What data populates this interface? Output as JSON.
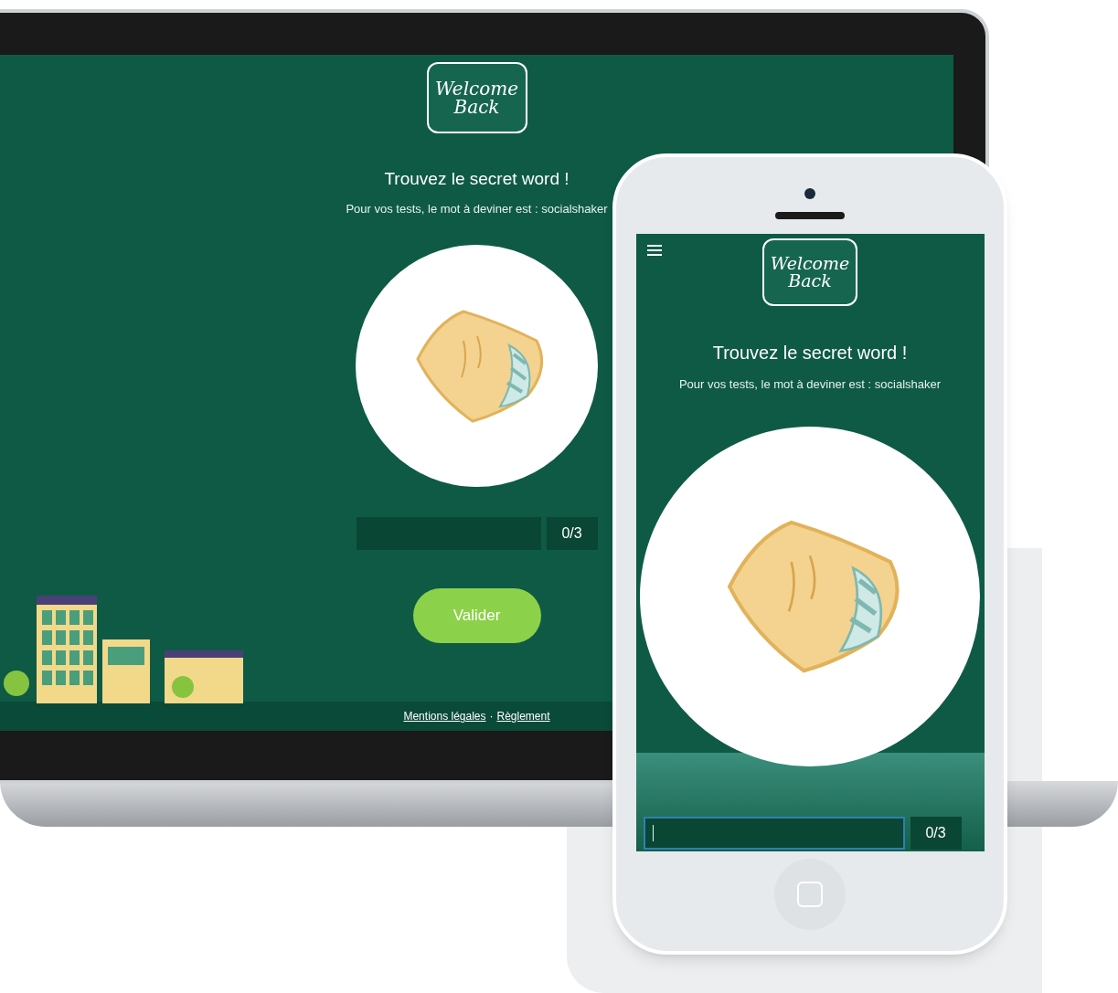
{
  "laptop": {
    "logo": [
      "Welcome",
      "Back"
    ],
    "title": "Trouvez le secret word !",
    "subtitle": "Pour vos tests, le mot à deviner est : socialshaker",
    "answer": {
      "focused": false,
      "counter": "0/3"
    },
    "button": "Valider",
    "footer_links": [
      {
        "label": "Mentions légales"
      },
      {
        "label": "Règlement"
      }
    ],
    "footer_separator": "·"
  },
  "phone": {
    "logo": [
      "Welcome",
      "Back"
    ],
    "title": "Trouvez le secret word !",
    "subtitle": "Pour vos tests, le mot à deviner est : socialshaker",
    "answer": {
      "focused": true,
      "counter": "0/3"
    }
  }
}
